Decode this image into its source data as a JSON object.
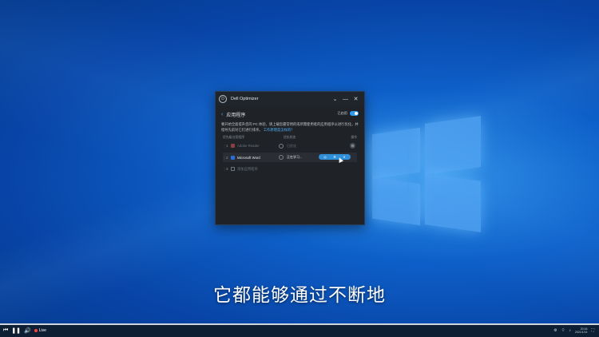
{
  "window": {
    "title": "Dell Optimizer",
    "minimize_glyph": "—",
    "close_glyph": "✕",
    "collapse_glyph": "⌄"
  },
  "page": {
    "heading": "应用程序",
    "toggle_label": "已启用",
    "toggle_on": true,
    "description": "要开始全面提升您的 PC 体验，请上载您最常用的或所需使用者的应用程序以进行优化，并指导先前对它们进行排序。",
    "link_text": "工作原理是怎样的？"
  },
  "table": {
    "headers": [
      "优先级",
      "应用程序",
      "优化状态",
      "操作"
    ],
    "rows": [
      {
        "index": "1",
        "name": "Adobe Reader",
        "status": "已优化",
        "active": false
      },
      {
        "index": "2",
        "name": "Microsoft Word",
        "status": "正在学习...",
        "active": true,
        "pill": [
          "◎",
          "⚙",
          "✕"
        ]
      },
      {
        "index": "3",
        "name": "添加应用程序",
        "status": "",
        "active": false
      }
    ]
  },
  "subtitle": "它都能够通过不断地",
  "player": {
    "live_label": "Live",
    "progress": 1.0,
    "clock_time": "20:16",
    "clock_date": "2021/1/14"
  },
  "colors": {
    "accent": "#2f9bea",
    "window_bg": "#1f2226",
    "desktop": "#0d5fc8"
  }
}
